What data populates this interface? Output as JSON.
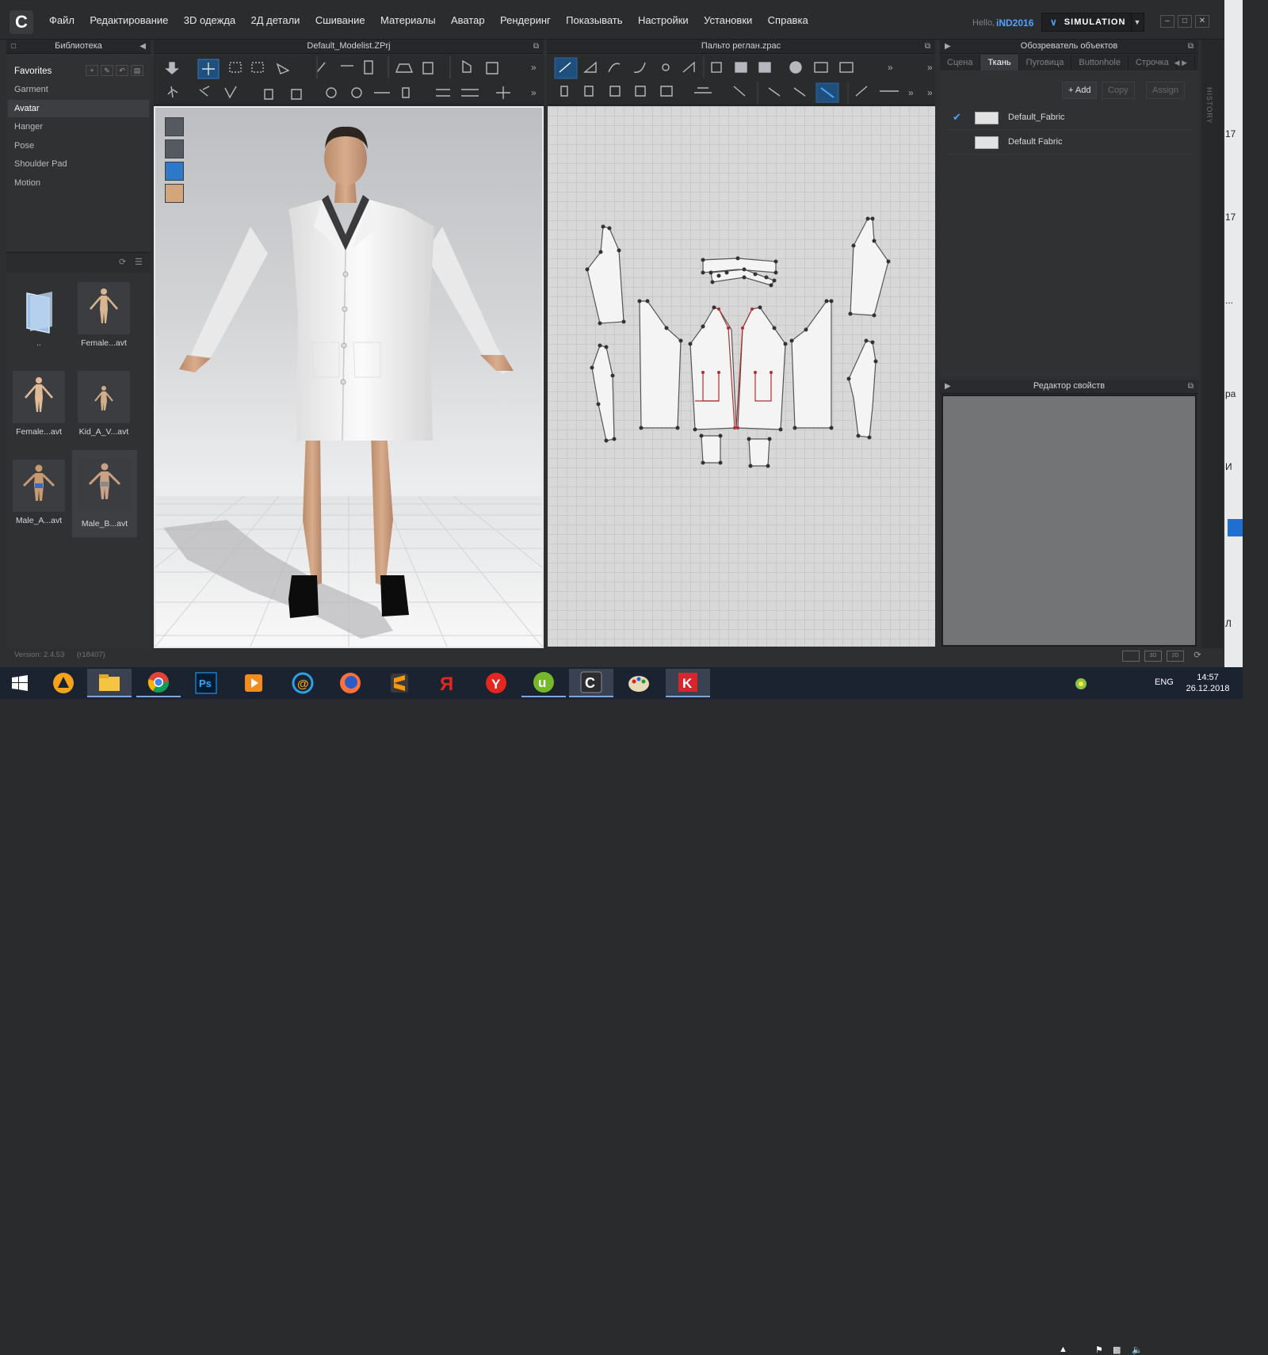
{
  "app": {
    "logo": "C",
    "hello": "Hello,",
    "user": "iND2016",
    "mode": "SIMULATION"
  },
  "menu": [
    "Файл",
    "Редактирование",
    "3D одежда",
    "2Д детали",
    "Сшивание",
    "Материалы",
    "Аватар",
    "Рендеринг",
    "Показывать",
    "Настройки",
    "Установки",
    "Справка"
  ],
  "library": {
    "title": "Библиотека",
    "items": [
      {
        "label": "Favorites"
      },
      {
        "label": "Garment"
      },
      {
        "label": "Avatar"
      },
      {
        "label": "Hanger"
      },
      {
        "label": "Pose"
      },
      {
        "label": "Shoulder Pad"
      },
      {
        "label": "Motion"
      }
    ],
    "selected": "Avatar",
    "thumbs": [
      {
        "label": ".."
      },
      {
        "label": "Female...avt"
      },
      {
        "label": "Female...avt"
      },
      {
        "label": "Kid_A_V...avt"
      },
      {
        "label": "Male_A...avt"
      },
      {
        "label": "Male_B...avt"
      }
    ],
    "version": "Version: 2.4.53",
    "build": "(r18407)"
  },
  "window3d": {
    "title": "Default_Modelist.ZPrj"
  },
  "window2d": {
    "title": "Пальто реглан.zpac"
  },
  "object_browser": {
    "title": "Обозреватель объектов",
    "tabs": [
      "Сцена",
      "Ткань",
      "Пуговица",
      "Buttonhole",
      "Строчка"
    ],
    "active_tab": "Ткань",
    "buttons": {
      "add": "+ Add",
      "copy": "Copy",
      "assign": "Assign"
    },
    "fabrics": [
      {
        "name": "Default_Fabric",
        "checked": true,
        "color": "#e2e2e2"
      },
      {
        "name": "Default Fabric",
        "checked": false,
        "color": "#e2e2e2"
      }
    ]
  },
  "property_editor": {
    "title": "Редактор свойств"
  },
  "history": {
    "label": "HISTORY"
  },
  "desktop_strip": {
    "texts": [
      "17",
      "17",
      "...",
      "ра",
      "И",
      "Л"
    ]
  },
  "taskbar": {
    "lang": "ENG",
    "time": "14:57",
    "date": "26.12.2018",
    "apps": [
      "start",
      "avast",
      "explorer",
      "chrome",
      "photoshop",
      "media",
      "mail",
      "firefox",
      "sublime",
      "yandex-browser",
      "yandex",
      "utorrent",
      "clo3d",
      "paint",
      "kaspersky"
    ]
  },
  "colors": {
    "accent": "#4ea3ff",
    "panel": "#303133",
    "titlebar": "#26272a",
    "taskbar": "#1b2230"
  }
}
